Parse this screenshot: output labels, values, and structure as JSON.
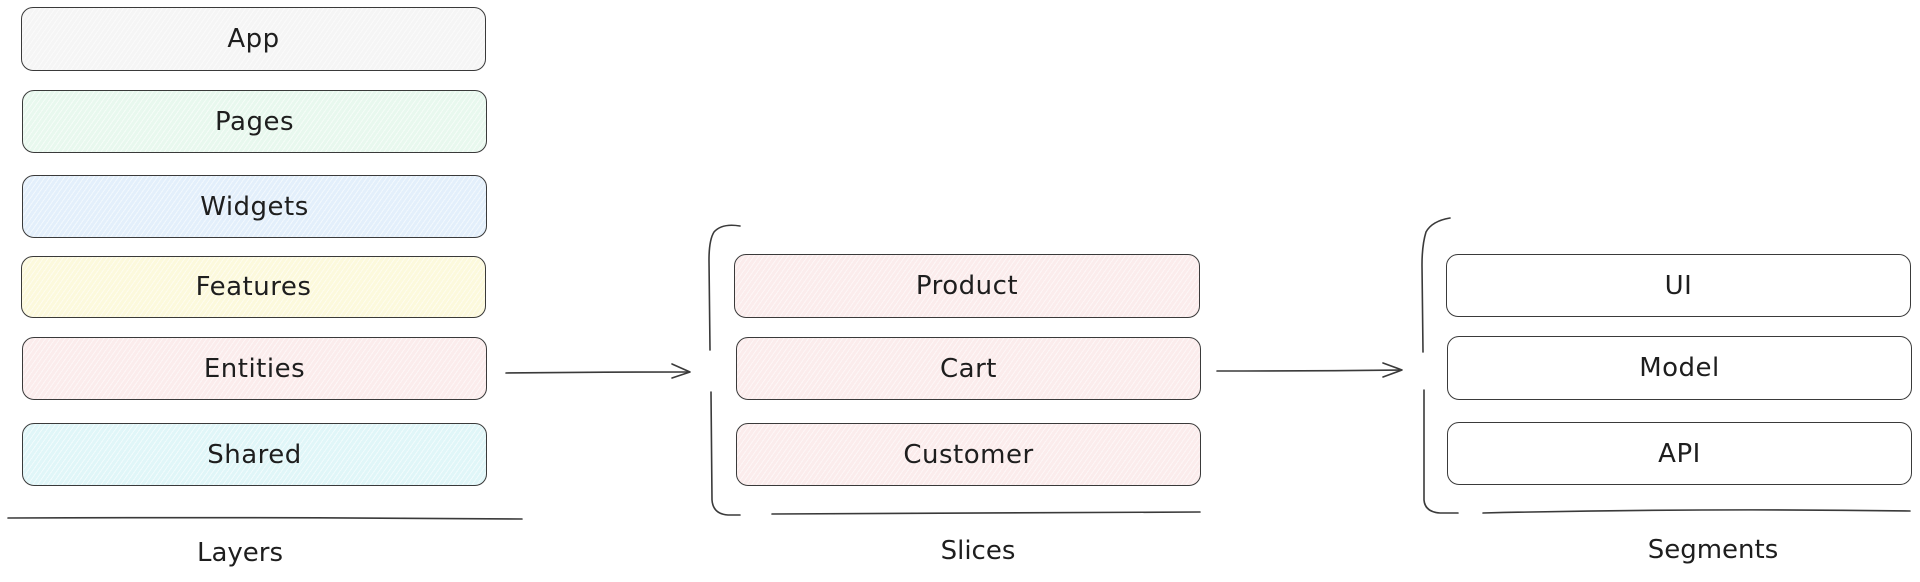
{
  "diagram": {
    "columns": [
      {
        "caption": "Layers",
        "items": [
          {
            "label": "App",
            "fill": "#f5f5f5"
          },
          {
            "label": "Pages",
            "fill": "#e8f8ee"
          },
          {
            "label": "Widgets",
            "fill": "#e3effb"
          },
          {
            "label": "Features",
            "fill": "#fcf9dc"
          },
          {
            "label": "Entities",
            "fill": "#fbecec"
          },
          {
            "label": "Shared",
            "fill": "#e0f6f8"
          }
        ]
      },
      {
        "caption": "Slices",
        "items": [
          {
            "label": "Product",
            "fill": "#fbecec"
          },
          {
            "label": "Cart",
            "fill": "#fbecec"
          },
          {
            "label": "Customer",
            "fill": "#fbecec"
          }
        ]
      },
      {
        "caption": "Segments",
        "items": [
          {
            "label": "UI",
            "fill": "#ffffff"
          },
          {
            "label": "Model",
            "fill": "#ffffff"
          },
          {
            "label": "API",
            "fill": "#ffffff"
          }
        ]
      }
    ],
    "connections": [
      {
        "from": "Entities",
        "to": "Slices"
      },
      {
        "from": "Cart",
        "to": "Segments"
      }
    ],
    "stroke_color": "#3a3a3a"
  }
}
